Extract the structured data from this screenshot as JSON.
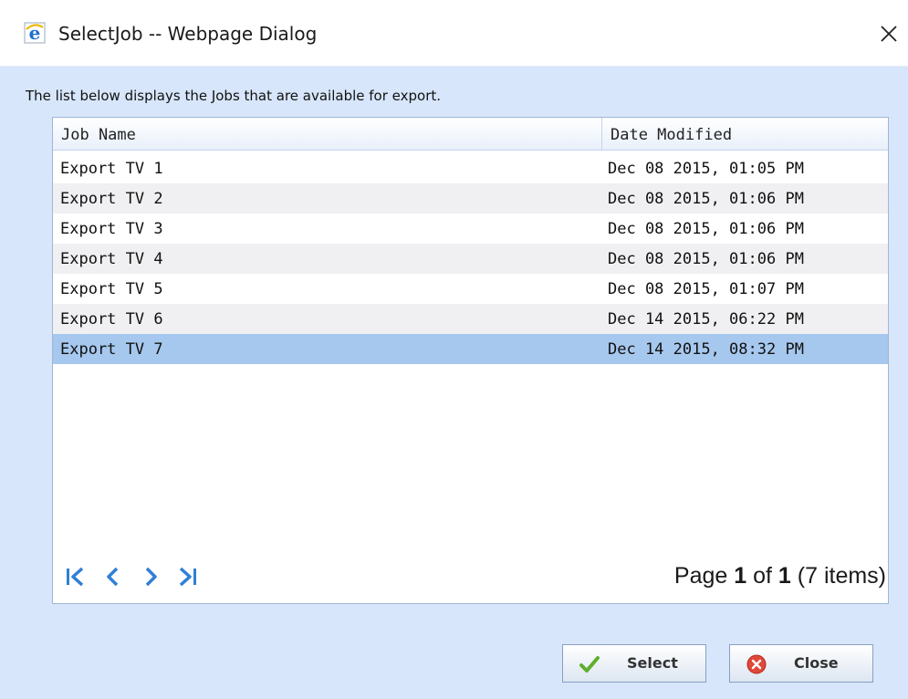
{
  "window": {
    "title": "SelectJob -- Webpage Dialog"
  },
  "description": "The list below displays the Jobs that are available for export.",
  "grid": {
    "columns": [
      "Job Name",
      "Date Modified"
    ],
    "rows": [
      {
        "name": "Export TV 1",
        "date": "Dec 08 2015, 01:05 PM"
      },
      {
        "name": "Export TV 2",
        "date": "Dec 08 2015, 01:06 PM"
      },
      {
        "name": "Export TV 3",
        "date": "Dec 08 2015, 01:06 PM"
      },
      {
        "name": "Export TV 4",
        "date": "Dec 08 2015, 01:06 PM"
      },
      {
        "name": "Export TV 5",
        "date": "Dec 08 2015, 01:07 PM"
      },
      {
        "name": "Export TV 6",
        "date": "Dec 14 2015, 06:22 PM"
      },
      {
        "name": "Export TV 7",
        "date": "Dec 14 2015, 08:32 PM"
      }
    ],
    "selected_row": 6
  },
  "pager": {
    "page_word": "Page",
    "current": "1",
    "of_word": "of",
    "total": "1",
    "items": "(7 items)"
  },
  "buttons": {
    "select_label": "Select",
    "close_label": "Close"
  },
  "colors": {
    "dialog_bg": "#d7e6fb",
    "selected_row": "#a6c8ee",
    "pager_icon": "#2f7fd6"
  }
}
